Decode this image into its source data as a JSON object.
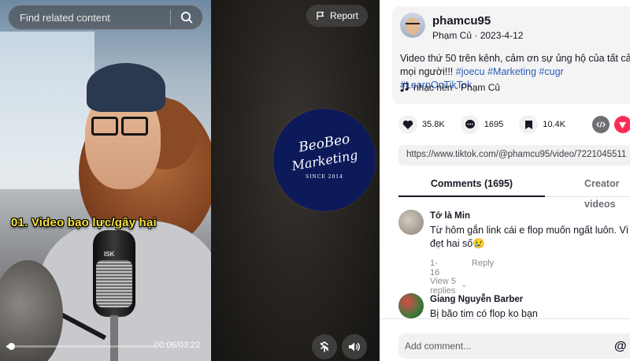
{
  "video": {
    "search_placeholder": "Find related content",
    "caption": "01. Video bạo lực/gây hại",
    "mic_brand": "ISK",
    "time": "00:06/03:22",
    "progress_fraction": 0.03
  },
  "middle": {
    "report_label": "Report",
    "logo": {
      "line1": "BeoBeo",
      "line2": "Marketing",
      "line3": "SINCE 2014"
    }
  },
  "post": {
    "username": "phamcu95",
    "display_name": "Phạm Củ",
    "date": "2023-4-12",
    "sub_separator": " · ",
    "description": "Video thứ 50 trên kênh, cảm ơn sự ủng hộ của tất cả mọi người!!!",
    "hashtags": [
      "#joecu",
      "#Marketing",
      "#cugr",
      "#LearnOnTikTok"
    ],
    "music": "nhạc nền - Phạm Củ"
  },
  "actions": {
    "likes": "35.8K",
    "comments": "1695",
    "saves": "10.4K"
  },
  "link": "https://www.tiktok.com/@phamcu95/video/7221045511",
  "tabs": {
    "comments": "Comments (1695)",
    "creator": "Creator videos"
  },
  "comments": [
    {
      "name": "Tớ là Min",
      "text_line1": "Từ hôm gắn link cái e flop muốn ngất luôn. Vì",
      "text_line2": "đẹt hai số😢",
      "date": "1-16",
      "reply": "Reply",
      "view_replies": "View 5 replies"
    },
    {
      "name": "Giang Nguyễn Barber",
      "text_line1": "Bị bão tim có flop ko bạn"
    }
  ],
  "comment_bar": {
    "placeholder": "Add comment..."
  },
  "colors": {
    "hashtag": "#2b5db9",
    "tiktok_red": "#fe2c55",
    "facebook_blue": "#1877f2",
    "caption_yellow": "#f7e13a",
    "logo_navy": "#0c1a5a"
  }
}
